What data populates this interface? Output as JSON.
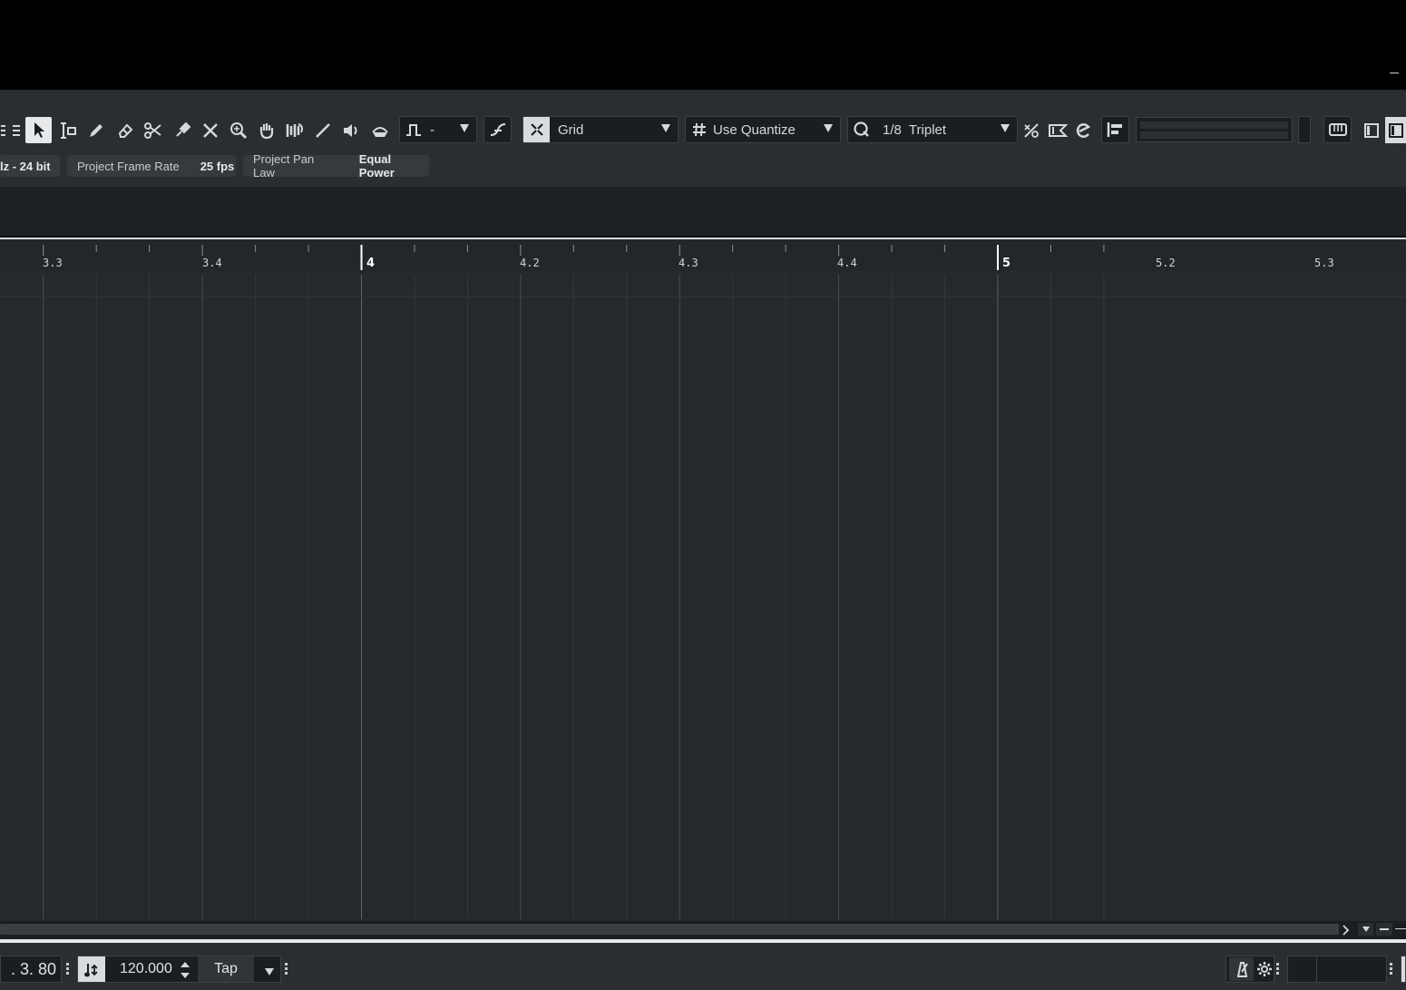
{
  "toolbar": {
    "automation_mode": "-",
    "snap_type": "Grid",
    "grid_type": "Use Quantize",
    "quantize_value": "1/8  Triplet"
  },
  "infobar": {
    "sample_rate_fragment": "lz - 24 bit",
    "frame_rate_label": "Project Frame Rate",
    "frame_rate_value": "25 fps",
    "pan_law_label": "Project Pan Law",
    "pan_law_value": "Equal Power"
  },
  "ruler": {
    "labels": [
      "3.3",
      "3.4",
      "4",
      "4.2",
      "4.3",
      "4.4",
      "5",
      "5.2",
      "5.3"
    ]
  },
  "transport": {
    "position": ". 3. 80",
    "tempo": "120.000",
    "tap_label": "Tap"
  },
  "icons": {
    "tools": [
      "object-selection-icon",
      "range-selection-icon",
      "draw-icon",
      "erase-icon",
      "split-icon",
      "glue-icon",
      "delete-icon",
      "zoom-icon",
      "hand-icon",
      "comp-icon",
      "line-icon",
      "mute-icon",
      "time-warp-icon"
    ]
  },
  "colors": {
    "toolbar_bg": "#2a2e32",
    "grid_bg": "#25292d",
    "accent_light": "#e6e8ea"
  }
}
